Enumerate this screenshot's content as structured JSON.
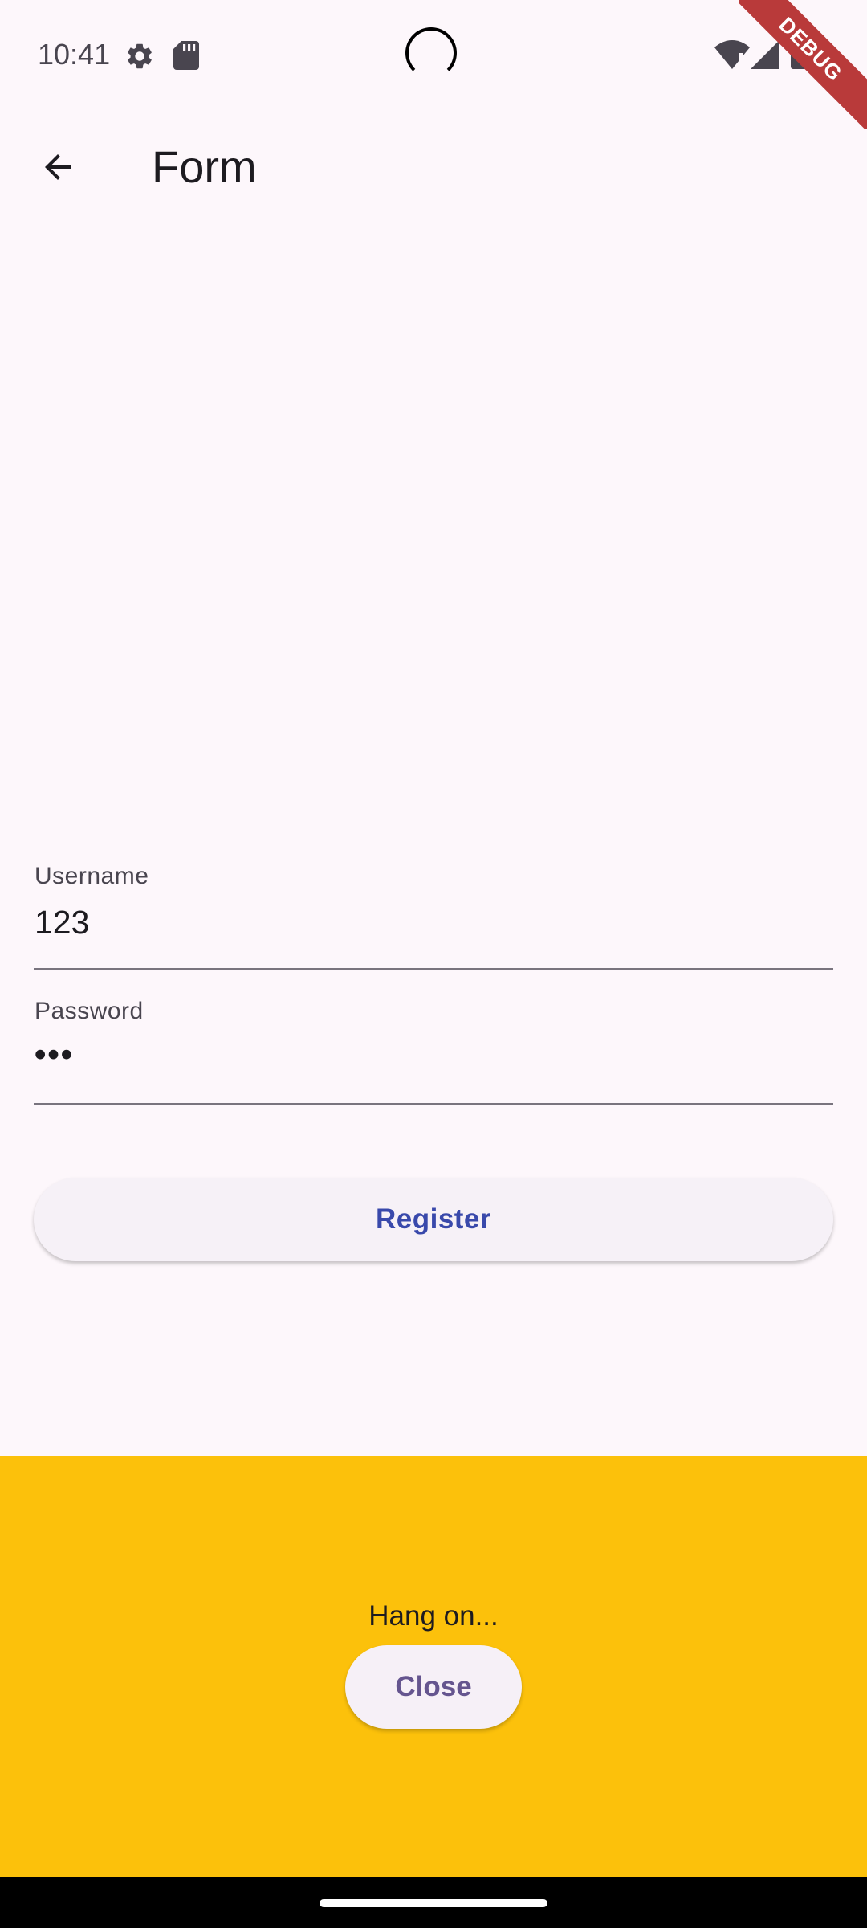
{
  "status_bar": {
    "time": "10:41",
    "icons": [
      "settings-icon",
      "sd-card-icon",
      "wifi-icon",
      "cell-signal-icon",
      "battery-icon"
    ]
  },
  "debug_banner": {
    "label": "DEBUG",
    "color": "#b93a3a"
  },
  "app_bar": {
    "back_icon": "arrow-back-icon",
    "title": "Form"
  },
  "form": {
    "username": {
      "label": "Username",
      "value": "123"
    },
    "password": {
      "label": "Password",
      "value": "•••"
    },
    "register_label": "Register"
  },
  "bottom_panel": {
    "message": "Hang on...",
    "close_label": "Close",
    "background_color": "#fcc10b"
  },
  "colors": {
    "background": "#fdf7fb",
    "primary_text": "#1d1b20",
    "register_text": "#3949ab",
    "close_text": "#65558f"
  }
}
